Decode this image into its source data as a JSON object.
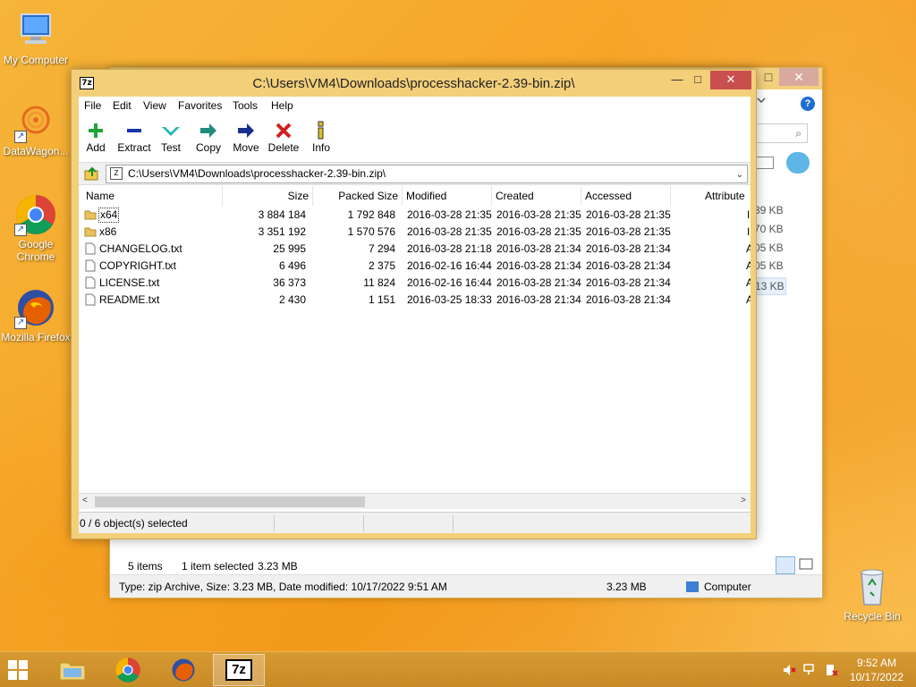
{
  "desktop": {
    "icons": [
      {
        "label": "My Computer"
      },
      {
        "label": "DataWagon..."
      },
      {
        "label": "Google Chrome"
      },
      {
        "label": "Mozilla Firefox"
      },
      {
        "label": "Recycle Bin"
      }
    ]
  },
  "explorer": {
    "sizes": [
      "39 KB",
      "70 KB",
      "05 KB",
      "05 KB",
      "13 KB"
    ],
    "items_count": "5 items",
    "selected_info": "1 item selected",
    "selected_size": "3.23 MB",
    "detail_text": "Type: zip Archive, Size: 3.23 MB, Date modified: 10/17/2022 9:51 AM",
    "detail_size": "3.23 MB",
    "location": "Computer"
  },
  "sevenzip": {
    "title": "C:\\Users\\VM4\\Downloads\\processhacker-2.39-bin.zip\\",
    "app_icon_text": "7z",
    "menu": [
      "File",
      "Edit",
      "View",
      "Favorites",
      "Tools",
      "Help"
    ],
    "toolbar": [
      "Add",
      "Extract",
      "Test",
      "Copy",
      "Move",
      "Delete",
      "Info"
    ],
    "address": "C:\\Users\\VM4\\Downloads\\processhacker-2.39-bin.zip\\",
    "columns": [
      "Name",
      "Size",
      "Packed Size",
      "Modified",
      "Created",
      "Accessed",
      "Attribute"
    ],
    "rows": [
      {
        "name": "x64",
        "size": "3 884 184",
        "packed": "1 792 848",
        "modified": "2016-03-28 21:35",
        "created": "2016-03-28 21:35",
        "accessed": "2016-03-28 21:35",
        "type": "folder"
      },
      {
        "name": "x86",
        "size": "3 351 192",
        "packed": "1 570 576",
        "modified": "2016-03-28 21:35",
        "created": "2016-03-28 21:35",
        "accessed": "2016-03-28 21:35",
        "type": "folder"
      },
      {
        "name": "CHANGELOG.txt",
        "size": "25 995",
        "packed": "7 294",
        "modified": "2016-03-28 21:18",
        "created": "2016-03-28 21:34",
        "accessed": "2016-03-28 21:34",
        "type": "file"
      },
      {
        "name": "COPYRIGHT.txt",
        "size": "6 496",
        "packed": "2 375",
        "modified": "2016-02-16 16:44",
        "created": "2016-03-28 21:34",
        "accessed": "2016-03-28 21:34",
        "type": "file"
      },
      {
        "name": "LICENSE.txt",
        "size": "36 373",
        "packed": "11 824",
        "modified": "2016-02-16 16:44",
        "created": "2016-03-28 21:34",
        "accessed": "2016-03-28 21:34",
        "type": "file"
      },
      {
        "name": "README.txt",
        "size": "2 430",
        "packed": "1 151",
        "modified": "2016-03-25 18:33",
        "created": "2016-03-28 21:34",
        "accessed": "2016-03-28 21:34",
        "type": "file"
      }
    ],
    "status": "0 / 6 object(s) selected"
  },
  "taskbar": {
    "time": "9:52 AM",
    "date": "10/17/2022",
    "active_app_text": "7z"
  }
}
